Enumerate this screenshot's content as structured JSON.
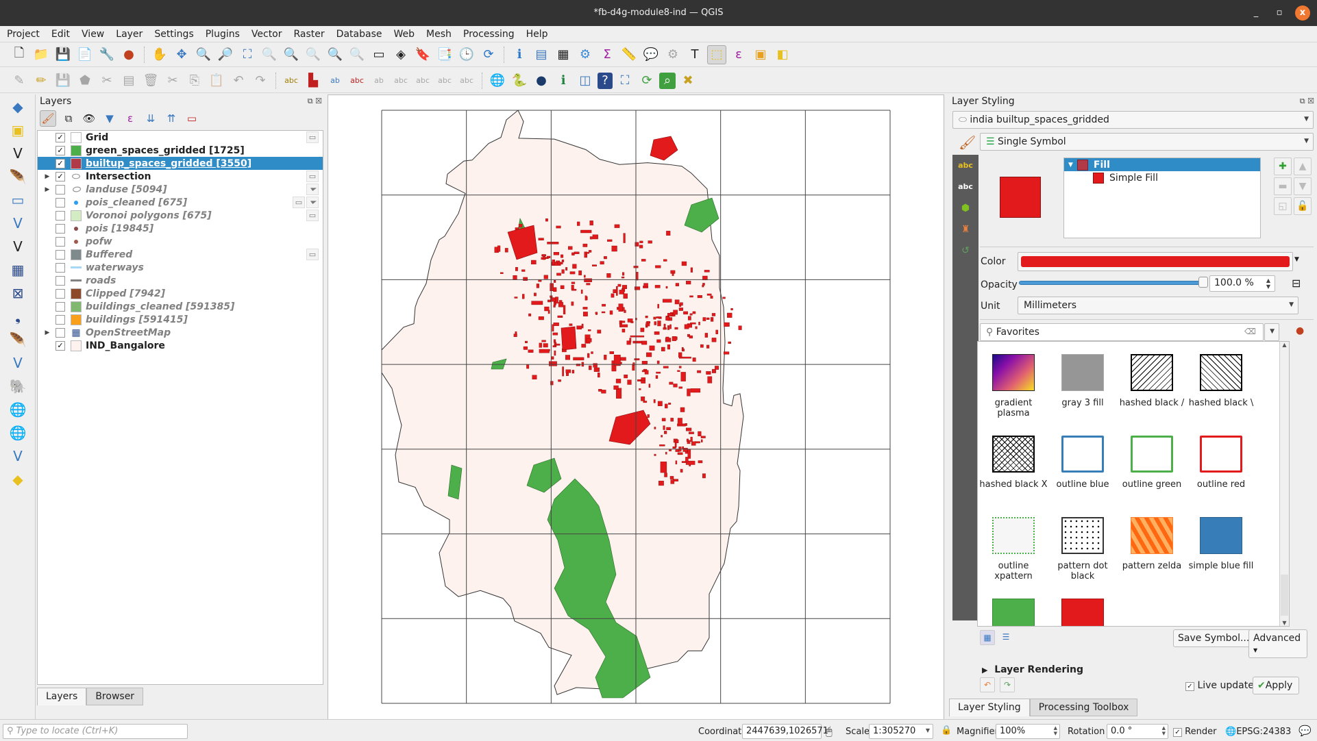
{
  "window": {
    "title": "*fb-d4g-module8-ind — QGIS",
    "minimize": "_",
    "maximize": "▫",
    "close": "x"
  },
  "menu": [
    "Project",
    "Edit",
    "View",
    "Layer",
    "Settings",
    "Plugins",
    "Vector",
    "Raster",
    "Database",
    "Web",
    "Mesh",
    "Processing",
    "Help"
  ],
  "layers_panel": {
    "title": "Layers",
    "layers": [
      {
        "name": "Grid",
        "checked": true,
        "visible": true,
        "symbol": "empty-square",
        "color": "#ffffff",
        "indicators": [
          "memory"
        ]
      },
      {
        "name": "green_spaces_gridded [1725]",
        "checked": true,
        "visible": true,
        "symbol": "fill",
        "color": "#4daf4a",
        "indicators": []
      },
      {
        "name": "builtup_spaces_gridded [3550]",
        "checked": true,
        "visible": true,
        "symbol": "fill",
        "color": "#b03a48",
        "selected": true,
        "indicators": []
      },
      {
        "name": "Intersection",
        "checked": true,
        "visible": true,
        "symbol": "polygon-icon",
        "expandable": true,
        "indicators": [
          "memory"
        ]
      },
      {
        "name": "landuse [5094]",
        "checked": false,
        "visible": false,
        "symbol": "polygon-icon",
        "expandable": true,
        "indicators": [
          "filter"
        ]
      },
      {
        "name": "pois_cleaned [675]",
        "checked": false,
        "visible": false,
        "symbol": "point",
        "color": "#2a9df4",
        "indicators": [
          "memory",
          "filter"
        ]
      },
      {
        "name": "Voronoi polygons [675]",
        "checked": false,
        "visible": false,
        "symbol": "fill",
        "color": "#d4ecc4",
        "indicators": [
          "memory"
        ]
      },
      {
        "name": "pois [19845]",
        "checked": false,
        "visible": false,
        "symbol": "point",
        "color": "#8b4a4a",
        "indicators": []
      },
      {
        "name": "pofw",
        "checked": false,
        "visible": false,
        "symbol": "point",
        "color": "#a0584a",
        "indicators": []
      },
      {
        "name": "Buffered",
        "checked": false,
        "visible": false,
        "symbol": "fill",
        "color": "#7f8a8c",
        "indicators": [
          "memory"
        ]
      },
      {
        "name": "waterways",
        "checked": false,
        "visible": false,
        "symbol": "line",
        "color": "#a6d8f5",
        "indicators": []
      },
      {
        "name": "roads",
        "checked": false,
        "visible": false,
        "symbol": "line",
        "color": "#808080",
        "indicators": []
      },
      {
        "name": "Clipped [7942]",
        "checked": false,
        "visible": false,
        "symbol": "fill",
        "color": "#8c4a2a",
        "indicators": []
      },
      {
        "name": "buildings_cleaned [591385]",
        "checked": false,
        "visible": false,
        "symbol": "fill",
        "color": "#80b870",
        "indicators": []
      },
      {
        "name": "buildings [591415]",
        "checked": false,
        "visible": false,
        "symbol": "fill",
        "color": "#f8a01c",
        "indicators": []
      },
      {
        "name": "OpenStreetMap",
        "checked": false,
        "visible": false,
        "symbol": "raster-icon",
        "expandable": true,
        "indicators": []
      },
      {
        "name": "IND_Bangalore",
        "checked": true,
        "visible": true,
        "symbol": "fill",
        "color": "#fdf2ee",
        "indicators": []
      }
    ],
    "tabs": [
      "Layers",
      "Browser"
    ]
  },
  "locator": {
    "placeholder": "Type to locate (Ctrl+K)"
  },
  "map": {
    "boundary_fill": "#fdf2ee",
    "builtup_color": "#e31a1c",
    "green_color": "#4daf4a",
    "grid_rows": 7,
    "grid_cols": 6
  },
  "styling": {
    "title": "Layer Styling",
    "layer": "india builtup_spaces_gridded",
    "renderer": "Single Symbol",
    "tree": [
      {
        "label": "Fill",
        "color": "#b03a48"
      },
      {
        "label": "Simple Fill",
        "color": "#e31a1c"
      }
    ],
    "color_label": "Color",
    "color": "#e31a1c",
    "opacity_label": "Opacity",
    "opacity_value": "100.0 %",
    "opacity": 1.0,
    "unit_label": "Unit",
    "unit": "Millimeters",
    "search": "Favorites",
    "symbols": [
      {
        "label": "gradient plasma",
        "style": "gradient"
      },
      {
        "label": "gray 3 fill",
        "style": "gray"
      },
      {
        "label": "hashed black /",
        "style": "hash-fwd"
      },
      {
        "label": "hashed black \\",
        "style": "hash-back"
      },
      {
        "label": "hashed black X",
        "style": "hash-x"
      },
      {
        "label": "outline blue",
        "style": "outline-blue"
      },
      {
        "label": "outline green",
        "style": "outline-green"
      },
      {
        "label": "outline red",
        "style": "outline-red"
      },
      {
        "label": "outline xpattern",
        "style": "xpattern"
      },
      {
        "label": "pattern dot black",
        "style": "dots"
      },
      {
        "label": "pattern zelda",
        "style": "zelda"
      },
      {
        "label": "simple blue fill",
        "style": "blue"
      },
      {
        "label": "",
        "style": "green"
      },
      {
        "label": "",
        "style": "red"
      }
    ],
    "save_symbol": "Save Symbol...",
    "advanced": "Advanced",
    "layer_rendering": "Layer Rendering",
    "live_update": "Live update",
    "live_update_checked": true,
    "apply": "Apply",
    "tabs": [
      "Layer Styling",
      "Processing Toolbox"
    ]
  },
  "status": {
    "coordinate_label": "Coordinate",
    "coordinate": "2447639,1026571",
    "scale_label": "Scale",
    "scale": "1:305270",
    "magnifier_label": "Magnifier",
    "magnifier": "100%",
    "rotation_label": "Rotation",
    "rotation": "0.0 °",
    "render_label": "Render",
    "render_checked": true,
    "crs": "EPSG:24383"
  }
}
